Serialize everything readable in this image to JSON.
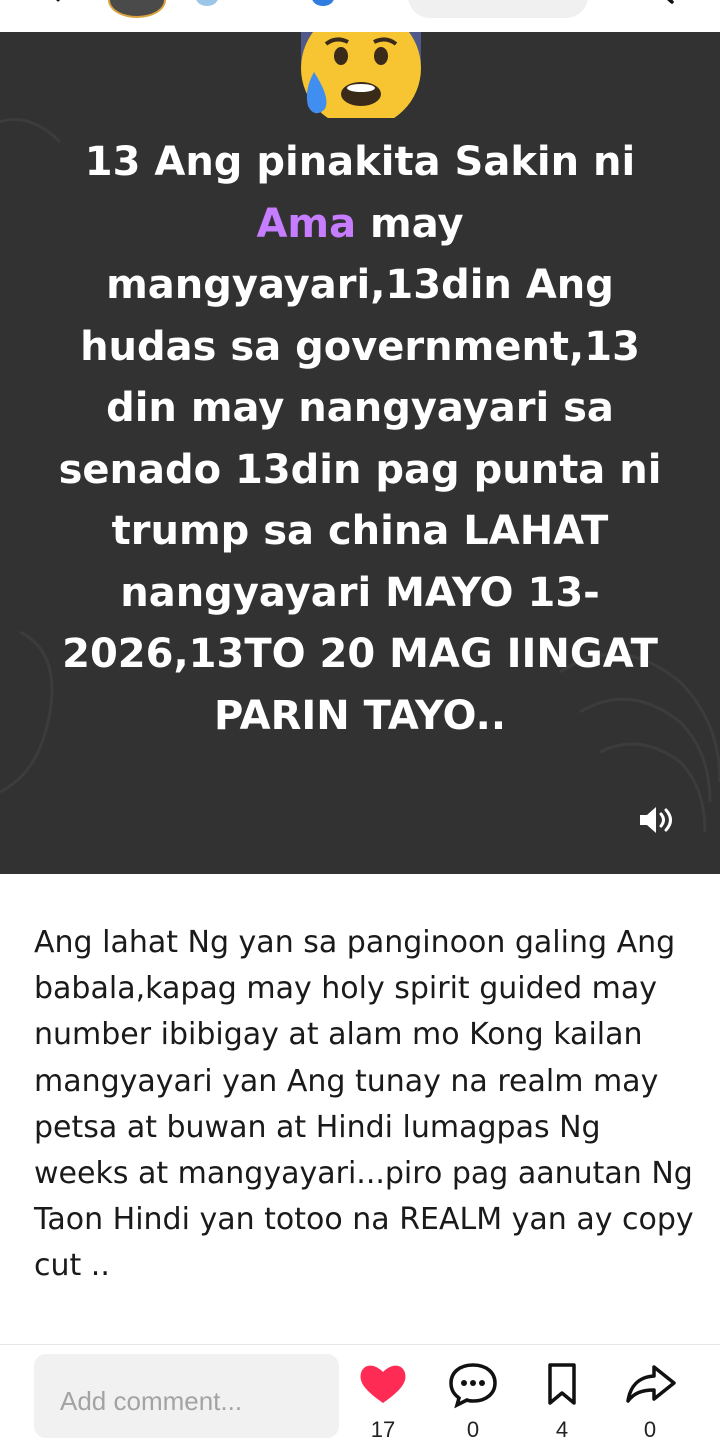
{
  "overlay": {
    "line1": "13 Ang pinakita Sakin ni",
    "highlight": "Ama",
    "after_highlight": " may",
    "rest": "mangyayari,13din Ang hudas sa government,13 din may nangyayari sa senado 13din pag punta ni trump sa china LAHAT nangyayari MAYO 13-2026,13TO 20 MAG IINGAT PARIN TAYO.."
  },
  "description": "Ang lahat Ng yan sa panginoon galing Ang babala,kapag may holy spirit guided may number ibibigay at alam mo Kong kailan mangyayari yan Ang tunay na realm may petsa at buwan at Hindi lumagpas Ng weeks at mangyayari...piro pag aanutan Ng Taon Hindi yan totoo na REALM yan ay copy cut ..",
  "comment": {
    "placeholder": "Add comment..."
  },
  "actions": {
    "likes": "17",
    "comments": "0",
    "saves": "4",
    "shares": "0"
  },
  "colors": {
    "media_bg": "#323232",
    "highlight": "#c77dff",
    "like_heart": "#fe2c55"
  },
  "icons": [
    "back-icon",
    "search-icon",
    "sad-emoji-icon",
    "sound-icon",
    "heart-icon",
    "comment-icon",
    "bookmark-icon",
    "share-icon"
  ]
}
